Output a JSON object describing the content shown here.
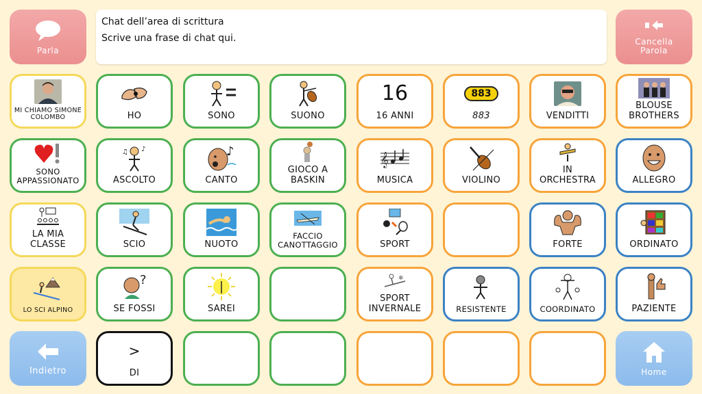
{
  "top": {
    "speak": {
      "label": "Parla"
    },
    "chat": {
      "title": "Chat dell’area di scrittura",
      "hint": "Scrive una frase di chat qui."
    },
    "delete_word": {
      "label": "Cancella Parola"
    }
  },
  "tiles": {
    "simone": "MI CHIAMO SIMONE COLOMBO",
    "ho": "HO",
    "sono": "SONO",
    "suono": "SUONO",
    "anni_num": "16",
    "anni": "16 ANNI",
    "radio_logo": "883",
    "radio": "883",
    "venditti": "VENDITTI",
    "blouse": "BLOUSE BROTHERS",
    "appassionato": "SONO APPASSIONATO",
    "ascolto": "ASCOLTO",
    "canto": "CANTO",
    "baskin": "GIOCO A BASKIN",
    "musica": "MUSICA",
    "violino": "VIOLINO",
    "orchestra": "IN ORCHESTRA",
    "allegro": "ALLEGRO",
    "classe": "LA MIA CLASSE",
    "scio": "SCIO",
    "nuoto": "NUOTO",
    "canottaggio": "FACCIO CANOTTAGGIO",
    "sport": "SPORT",
    "forte": "FORTE",
    "ordinato": "ORDINATO",
    "sci_alpino": "LO SCI ALPINO",
    "se_fossi": "SE FOSSI",
    "sarei": "SAREI",
    "sport_invernale": "SPORT INVERNALE",
    "resistente": "RESISTENTE",
    "coordinato": "COORDINATO",
    "paziente": "PAZIENTE",
    "di_symbol": ">",
    "di": "DI"
  },
  "bottom": {
    "back": {
      "label": "Indietro"
    },
    "home": {
      "label": "Home"
    }
  },
  "colors": {
    "pink": "#eb8f8f",
    "blue": "#8cbbec",
    "green": "#4caf50",
    "orange": "#f7a43a",
    "yellow": "#f5d85a",
    "dark_blue": "#3b82c4",
    "background": "#fff4d6"
  },
  "icons": {
    "speak": "speech-bubble-icon",
    "delete_word": "delete-arrow-icon",
    "back": "left-arrow-icon",
    "home": "home-icon"
  }
}
